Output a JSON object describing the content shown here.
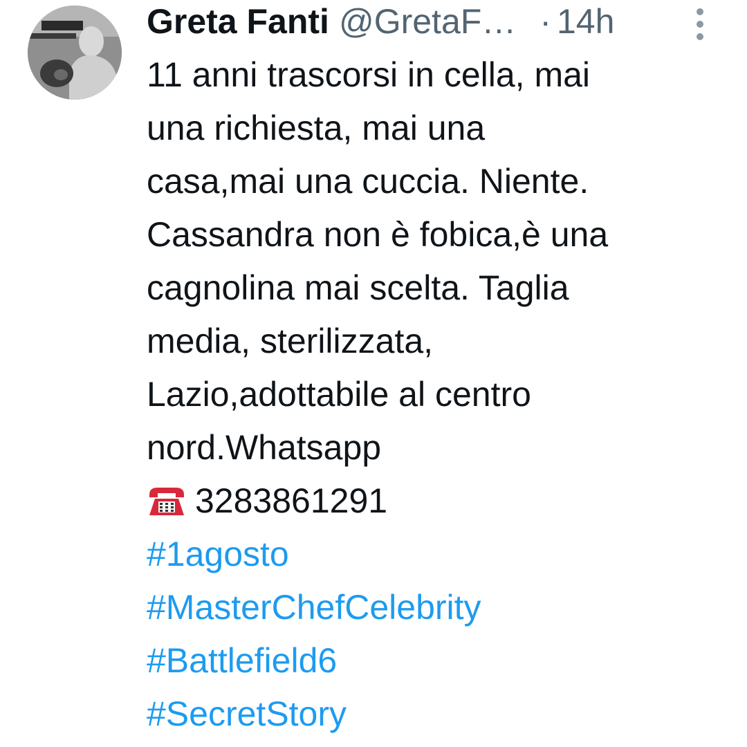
{
  "tweet": {
    "author_name": "Greta Fanti",
    "author_handle": "@GretaF…",
    "separator": "·",
    "timestamp": "14h",
    "text_lines": [
      "11 anni trascorsi in cella, mai",
      "una richiesta, mai una",
      "casa,mai una cuccia. Niente.",
      "Cassandra non è fobica,è una",
      "cagnolina mai scelta. Taglia",
      "media, sterilizzata,",
      "Lazio,adottabile al centro",
      "nord.Whatsapp"
    ],
    "phone_emoji": "telephone-icon",
    "phone_number": "3283861291",
    "hashtags": [
      "#1agosto",
      "#MasterChefCelebrity",
      "#Battlefield6",
      "#SecretStory"
    ]
  },
  "colors": {
    "text": "#0f1419",
    "secondary": "#536471",
    "link": "#1d9bf0",
    "phone_red": "#d8283a"
  }
}
